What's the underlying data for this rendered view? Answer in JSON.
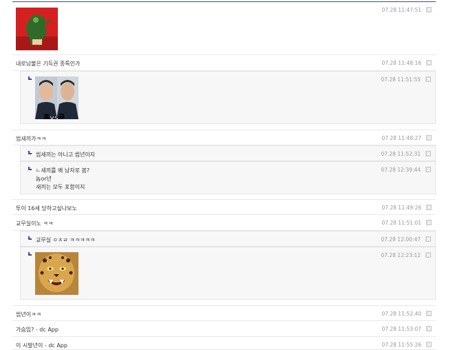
{
  "comments": [
    {
      "text": "",
      "date": "07.28 11:47:51"
    },
    {
      "text": "내로남불은 기득권 종특인가",
      "date": "07.28 11:48:16"
    },
    {
      "text": "",
      "date": "07.28 11:51:55",
      "image_caption": "조vs국"
    },
    {
      "text": "씹새끼가ㅋㅋ",
      "date": "07.28 11:48:27"
    },
    {
      "text": "씹새끼는 아니고 씹년이지",
      "date": "07.28 11:52:31"
    },
    {
      "text": "ㄴ새끼를 왜 남자로 봄?\n놈or년\n새끼는 모두 포함이지",
      "date": "07.28 12:39:44"
    },
    {
      "text": "투이 16세 당하고싶나보노",
      "date": "07.28 11:49:26"
    },
    {
      "text": "교무실이노 ㅋㅋ",
      "date": "07.28 11:51:01"
    },
    {
      "text": "교무실 ㅇㅈㄹ ㅋㅋㅋㅋㅋ",
      "date": "07.28 12:00:47"
    },
    {
      "text": "",
      "date": "07.28 12:23:12"
    },
    {
      "text": "씹년이ㅋㅋ",
      "date": "07.28 11:52:40"
    },
    {
      "text": "가슴임? - dc App",
      "date": "07.28 11:53:07"
    },
    {
      "text": "이 시발년이 - dc App",
      "date": "07.28 11:55:26"
    }
  ]
}
